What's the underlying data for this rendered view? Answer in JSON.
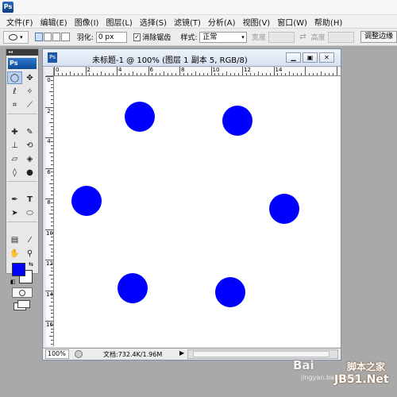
{
  "app": {
    "logo_text": "Ps"
  },
  "menu": [
    "文件(F)",
    "编辑(E)",
    "图像(I)",
    "图层(L)",
    "选择(S)",
    "滤镜(T)",
    "分析(A)",
    "视图(V)",
    "窗口(W)",
    "帮助(H)"
  ],
  "options": {
    "feather_label": "羽化:",
    "feather_value": "0 px",
    "antialias_label": "消除锯齿",
    "antialias_checked": true,
    "style_label": "样式:",
    "style_value": "正常",
    "width_label": "宽度",
    "height_label": "高度",
    "refine_label": "调整边缘"
  },
  "toolbox": {
    "logo": "Ps",
    "tools": [
      "marquee-tool",
      "move-tool",
      "lasso-tool",
      "magic-wand-tool",
      "crop-tool",
      "slice-tool",
      "healing-tool",
      "brush-tool",
      "stamp-tool",
      "history-brush-tool",
      "eraser-tool",
      "bucket-tool",
      "blur-tool",
      "dodge-tool",
      "pen-tool",
      "type-tool",
      "path-select-tool",
      "shape-tool",
      "notes-tool",
      "eyedropper-tool",
      "hand-tool",
      "zoom-tool"
    ],
    "foreground_color": "#0000ff",
    "background_color": "#ffffff"
  },
  "document": {
    "title": "未标题-1 @ 100% (图层 1 副本 5, RGB/8)",
    "ruler_h_labels": [
      "0",
      "2",
      "4",
      "6",
      "8",
      "10",
      "12",
      "14"
    ],
    "ruler_v_labels": [
      "0",
      "2",
      "4",
      "6",
      "8",
      "10",
      "12",
      "14",
      "16"
    ],
    "dot_color": "#0000ff",
    "dot_count": 6
  },
  "status": {
    "zoom": "100%",
    "doc_info": "文档:732.4K/1.96M"
  },
  "watermark": {
    "baidu": "Bai",
    "jingyan": "jingyan.baidu.com",
    "jiaoben": "脚本之家",
    "jb51": "JB51.Net"
  }
}
